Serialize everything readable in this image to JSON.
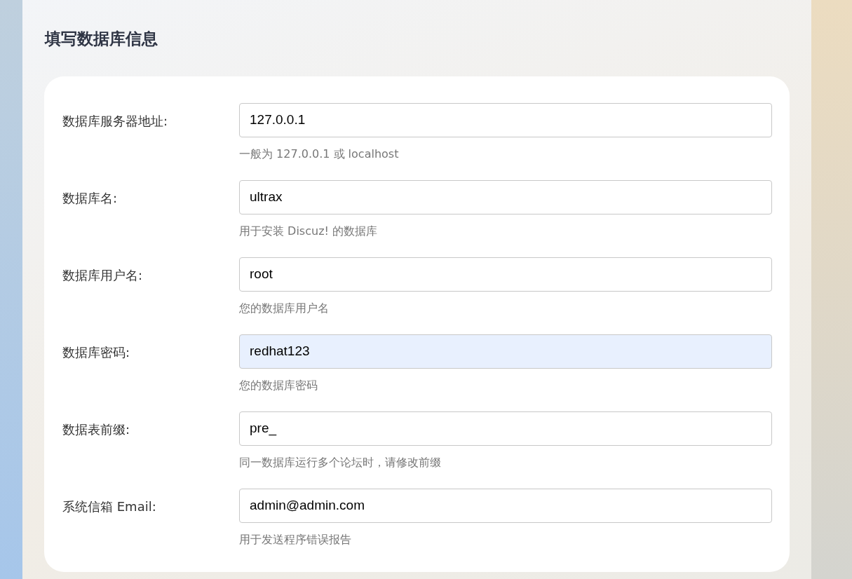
{
  "title": "填写数据库信息",
  "fields": [
    {
      "label": "数据库服务器地址:",
      "value": "127.0.0.1",
      "hint": "一般为 127.0.0.1 或 localhost",
      "autofilled": false
    },
    {
      "label": "数据库名:",
      "value": "ultrax",
      "hint": "用于安装 Discuz! 的数据库",
      "autofilled": false
    },
    {
      "label": "数据库用户名:",
      "value": "root",
      "hint": "您的数据库用户名",
      "autofilled": false
    },
    {
      "label": "数据库密码:",
      "value": "redhat123",
      "hint": "您的数据库密码",
      "autofilled": true
    },
    {
      "label": "数据表前缀:",
      "value": "pre_",
      "hint": "同一数据库运行多个论坛时，请修改前缀",
      "autofilled": false
    },
    {
      "label": "系统信箱 Email:",
      "value": "admin@admin.com",
      "hint": "用于发送程序错误报告",
      "autofilled": false
    }
  ]
}
